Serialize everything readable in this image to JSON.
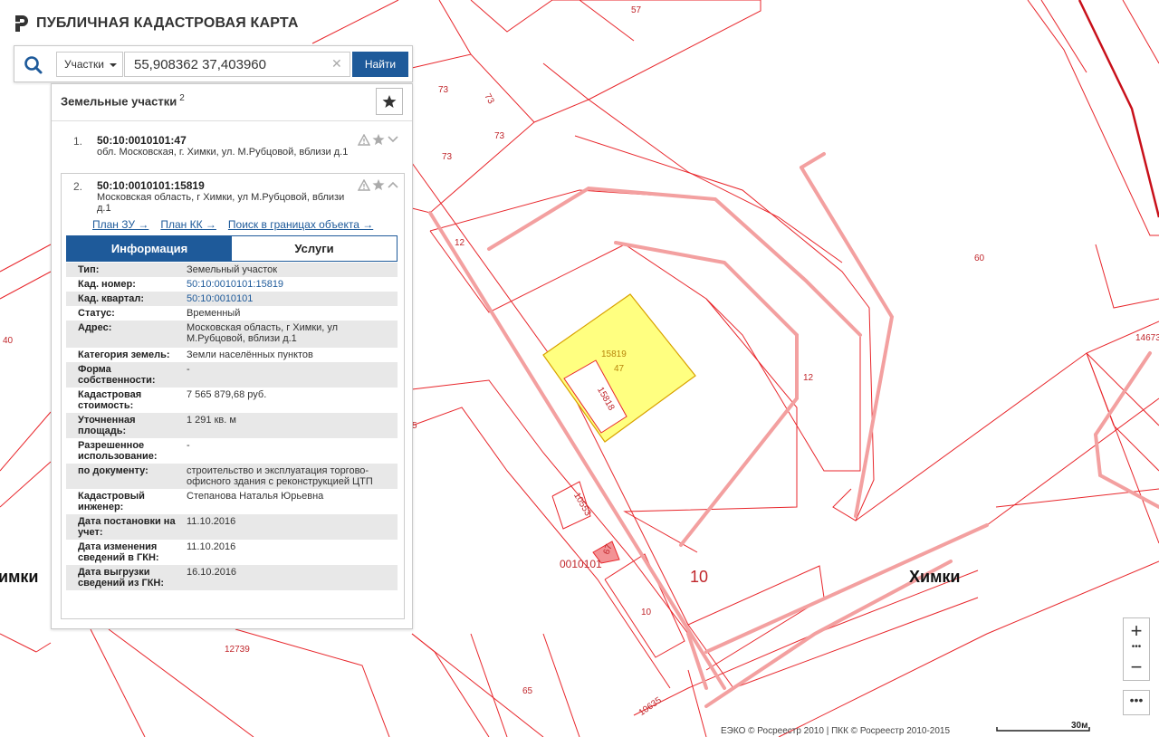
{
  "app": {
    "title": "ПУБЛИЧНАЯ КАДАСТРОВАЯ КАРТА"
  },
  "search": {
    "type_label": "Участки",
    "value": "55,908362 37,403960",
    "find_label": "Найти"
  },
  "panel": {
    "title": "Земельные участки",
    "count": "2"
  },
  "results": [
    {
      "num": "1.",
      "cad": "50:10:0010101:47",
      "addr": "обл. Московская, г. Химки, ул. М.Рубцовой, вблизи д.1"
    },
    {
      "num": "2.",
      "cad": "50:10:0010101:15819",
      "addr": "Московская область, г Химки, ул М.Рубцовой, вблизи д.1"
    }
  ],
  "links": {
    "plan_zu": "План ЗУ →",
    "plan_kk": "План КК →",
    "search_bounds": "Поиск в границах объекта →"
  },
  "tabs": {
    "info": "Информация",
    "services": "Услуги"
  },
  "info": {
    "rows": [
      {
        "k": "Тип:",
        "v": "Земельный участок"
      },
      {
        "k": "Кад. номер:",
        "v": "50:10:0010101:15819"
      },
      {
        "k": "Кад. квартал:",
        "v": "50:10:0010101"
      },
      {
        "k": "Статус:",
        "v": "Временный"
      },
      {
        "k": "Адрес:",
        "v": "Московская область, г Химки, ул М.Рубцовой, вблизи д.1"
      },
      {
        "k": "Категория земель:",
        "v": "Земли населённых пунктов"
      },
      {
        "k": "Форма собственности:",
        "v": "-"
      },
      {
        "k": "Кадастровая стоимость:",
        "v": "7 565 879,68 руб."
      },
      {
        "k": "Уточненная площадь:",
        "v": "1 291 кв. м"
      },
      {
        "k": "Разрешенное использование:",
        "v": "-"
      },
      {
        "k": "по документу:",
        "v": "строительство и эксплуатация торгово-офисного здания с реконструкцией ЦТП"
      },
      {
        "k": "Кадастровый инженер:",
        "v": "Степанова Наталья Юрьевна"
      },
      {
        "k": "Дата постановки на учет:",
        "v": "11.10.2016"
      },
      {
        "k": "Дата изменения сведений в ГКН:",
        "v": "11.10.2016"
      },
      {
        "k": "Дата выгрузки сведений из ГКН:",
        "v": "16.10.2016"
      }
    ]
  },
  "map": {
    "labels": {
      "l57": "57",
      "l73a": "73",
      "l73b": "73",
      "l73c": "73",
      "l73d": "73",
      "l12a": "12",
      "l12b": "12",
      "l60": "60",
      "l40": "40",
      "l14673": "14673",
      "l15819": "15819",
      "l47": "47",
      "l15818": "15818",
      "l10553": "10553",
      "l67": "67",
      "lq": "0010101",
      "l10big": "10",
      "l10small": "10",
      "l12739": "12739",
      "l65": "65",
      "l10635": "10635",
      "l5": "5",
      "city_right": "Химки",
      "city_left": "Химки"
    }
  },
  "zoom": {
    "in": "+",
    "out": "−",
    "dots": "•••"
  },
  "more": "•••",
  "attribution": "ЕЭКО © Росреестр 2010 | ПКК © Росреестр 2010-2015",
  "scale_label": "30м",
  "colors": {
    "accent": "#1e5a9a",
    "parcel_line": "#e8262b",
    "selected_fill": "#ffff80",
    "road": "#f3a0a0"
  }
}
